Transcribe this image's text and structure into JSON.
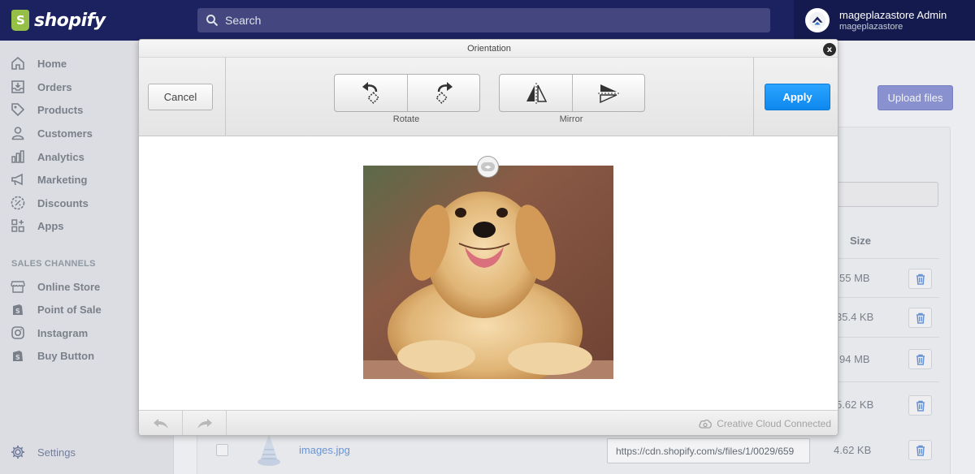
{
  "brand": {
    "name": "shopify"
  },
  "search": {
    "placeholder": "Search"
  },
  "account": {
    "name": "mageplazastore Admin",
    "store": "mageplazastore"
  },
  "sidebar": {
    "items": [
      {
        "label": "Home",
        "icon": "home-icon"
      },
      {
        "label": "Orders",
        "icon": "orders-icon"
      },
      {
        "label": "Products",
        "icon": "tag-icon"
      },
      {
        "label": "Customers",
        "icon": "person-icon"
      },
      {
        "label": "Analytics",
        "icon": "bar-chart-icon"
      },
      {
        "label": "Marketing",
        "icon": "megaphone-icon"
      },
      {
        "label": "Discounts",
        "icon": "discount-icon"
      },
      {
        "label": "Apps",
        "icon": "apps-icon"
      }
    ],
    "section_title": "SALES CHANNELS",
    "channels": [
      {
        "label": "Online Store",
        "icon": "store-icon"
      },
      {
        "label": "Point of Sale",
        "icon": "shopping-bag-icon"
      },
      {
        "label": "Instagram",
        "icon": "instagram-icon"
      },
      {
        "label": "Buy Button",
        "icon": "shopping-bag-icon"
      }
    ],
    "settings": {
      "label": "Settings",
      "icon": "gear-icon"
    }
  },
  "page": {
    "upload_label": "Upload files",
    "size_header": "Size",
    "sizes": [
      "55 MB",
      "35.4 KB",
      "94 MB",
      "5.62 KB",
      "4.62 KB"
    ],
    "last_file": {
      "name": "images.jpg",
      "url": "https://cdn.shopify.com/s/files/1/0029/659"
    }
  },
  "modal": {
    "title": "Orientation",
    "cancel_label": "Cancel",
    "apply_label": "Apply",
    "rotate_label": "Rotate",
    "mirror_label": "Mirror",
    "close_label": "x",
    "status": "Creative Cloud Connected",
    "accent_color": "#1693f5"
  }
}
